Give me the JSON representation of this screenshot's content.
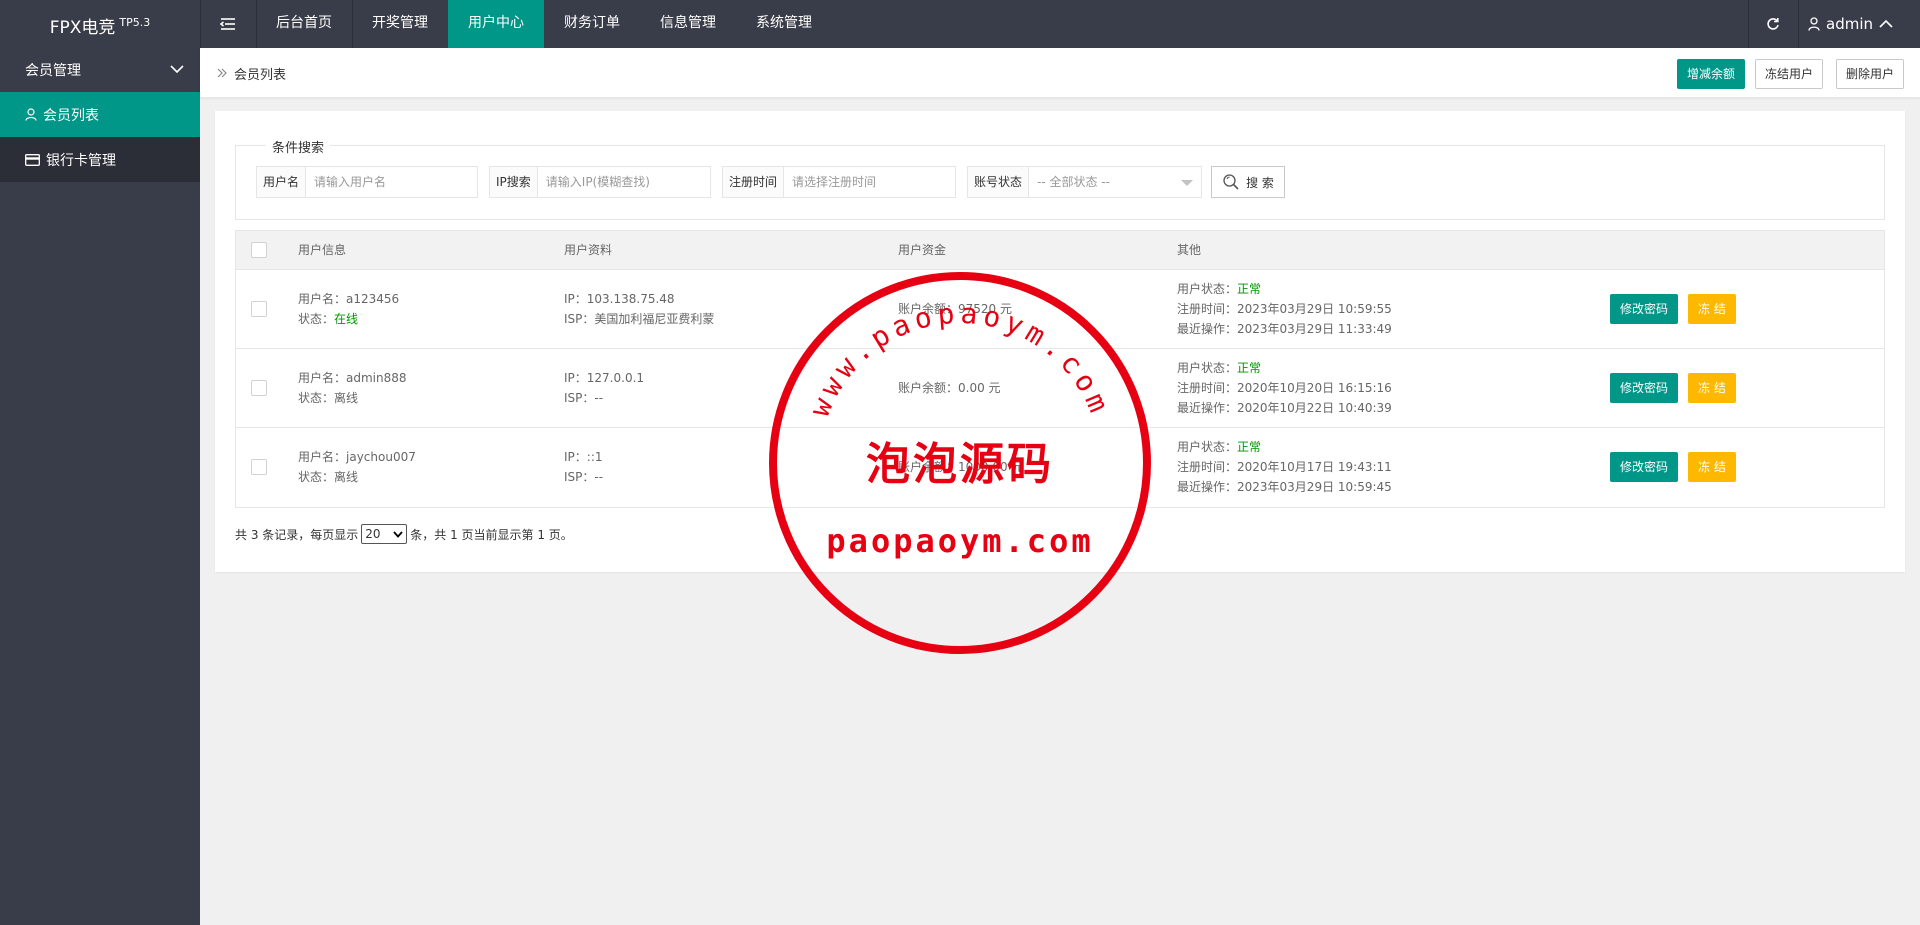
{
  "app": {
    "logo": "FPX电竞",
    "version": "TP5.3",
    "user": "admin"
  },
  "topnav": [
    {
      "label": "后台首页",
      "active": false
    },
    {
      "label": "开奖管理",
      "active": false
    },
    {
      "label": "用户中心",
      "active": true
    },
    {
      "label": "财务订单",
      "active": false
    },
    {
      "label": "信息管理",
      "active": false
    },
    {
      "label": "系统管理",
      "active": false
    }
  ],
  "sidebar": {
    "group": "会员管理",
    "items": [
      {
        "label": "会员列表",
        "icon": "user-icon",
        "active": true
      },
      {
        "label": "银行卡管理",
        "icon": "card-icon",
        "active": false
      }
    ]
  },
  "breadcrumb": "会员列表",
  "header_buttons": {
    "add_balance": "增减余额",
    "freeze_user": "冻结用户",
    "delete_user": "删除用户"
  },
  "search": {
    "legend": "条件搜索",
    "username": {
      "label": "用户名",
      "placeholder": "请输入用户名"
    },
    "ip": {
      "label": "IP搜索",
      "placeholder": "请输入IP(模糊查找)"
    },
    "regtime": {
      "label": "注册时间",
      "placeholder": "请选择注册时间"
    },
    "status": {
      "label": "账号状态",
      "value": "-- 全部状态 --"
    },
    "button": "搜 索"
  },
  "table": {
    "headers": [
      "用户信息",
      "用户资料",
      "用户资金",
      "其他"
    ],
    "rows": [
      {
        "username": "用户名：a123456",
        "status_label": "状态：",
        "status": "在线",
        "ip": "IP：103.138.75.48",
        "isp": "ISP：美国加利福尼亚费利蒙",
        "balance": "账户余额：97520 元",
        "user_status_label": "用户状态：",
        "user_status": "正常",
        "reg_time": "注册时间：2023年03月29日 10:59:55",
        "last_op": "最近操作：2023年03月29日 11:33:49",
        "btn_pwd": "修改密码",
        "btn_freeze": "冻 结"
      },
      {
        "username": "用户名：admin888",
        "status_label": "状态：",
        "status": "离线",
        "ip": "IP：127.0.0.1",
        "isp": "ISP：--",
        "balance": "账户余额：0.00 元",
        "user_status_label": "用户状态：",
        "user_status": "正常",
        "reg_time": "注册时间：2020年10月20日 16:15:16",
        "last_op": "最近操作：2020年10月22日 10:40:39",
        "btn_pwd": "修改密码",
        "btn_freeze": "冻 结"
      },
      {
        "username": "用户名：jaychou007",
        "status_label": "状态：",
        "status": "离线",
        "ip": "IP：::1",
        "isp": "ISP：--",
        "balance": "账户余额：1000.00 元",
        "user_status_label": "用户状态：",
        "user_status": "正常",
        "reg_time": "注册时间：2020年10月17日 19:43:11",
        "last_op": "最近操作：2023年03月29日 10:59:45",
        "btn_pwd": "修改密码",
        "btn_freeze": "冻 结"
      }
    ]
  },
  "pager": {
    "prefix": "共 3 条记录，每页显示",
    "per_page": "20",
    "suffix": "条，共 1 页当前显示第 1 页。"
  },
  "watermark": {
    "top": "www.paopaoym.com",
    "center": "泡泡源码",
    "bottom": "paopaoym.com"
  },
  "colors": {
    "topbar": "#393d49",
    "accent": "#009688",
    "warning": "#ffb800",
    "ok_text": "#009600",
    "stamp": "#e60012"
  }
}
